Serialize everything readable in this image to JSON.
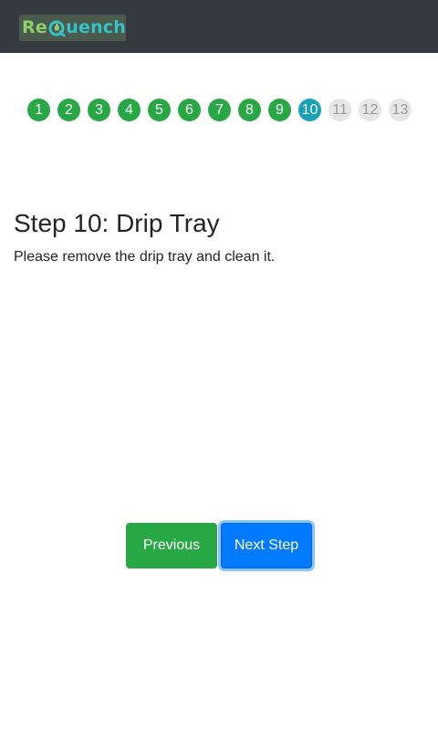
{
  "brand": {
    "logo_part1": "Re",
    "logo_part2": "uench",
    "logo_icon": "droplet-q-icon"
  },
  "steps": [
    {
      "label": "1",
      "state": "done"
    },
    {
      "label": "2",
      "state": "done"
    },
    {
      "label": "3",
      "state": "done"
    },
    {
      "label": "4",
      "state": "done"
    },
    {
      "label": "5",
      "state": "done"
    },
    {
      "label": "6",
      "state": "done"
    },
    {
      "label": "7",
      "state": "done"
    },
    {
      "label": "8",
      "state": "done"
    },
    {
      "label": "9",
      "state": "done"
    },
    {
      "label": "10",
      "state": "current"
    },
    {
      "label": "11",
      "state": "todo"
    },
    {
      "label": "12",
      "state": "todo"
    },
    {
      "label": "13",
      "state": "todo"
    }
  ],
  "content": {
    "title": "Step 10: Drip Tray",
    "description": "Please remove the drip tray and clean it."
  },
  "buttons": {
    "previous": "Previous",
    "next": "Next Step"
  },
  "colors": {
    "navbar": "#343a40",
    "step_done": "#28a745",
    "step_current": "#17a2b8",
    "step_todo": "#e6e6e6",
    "btn_previous": "#28a745",
    "btn_next": "#007bff"
  }
}
